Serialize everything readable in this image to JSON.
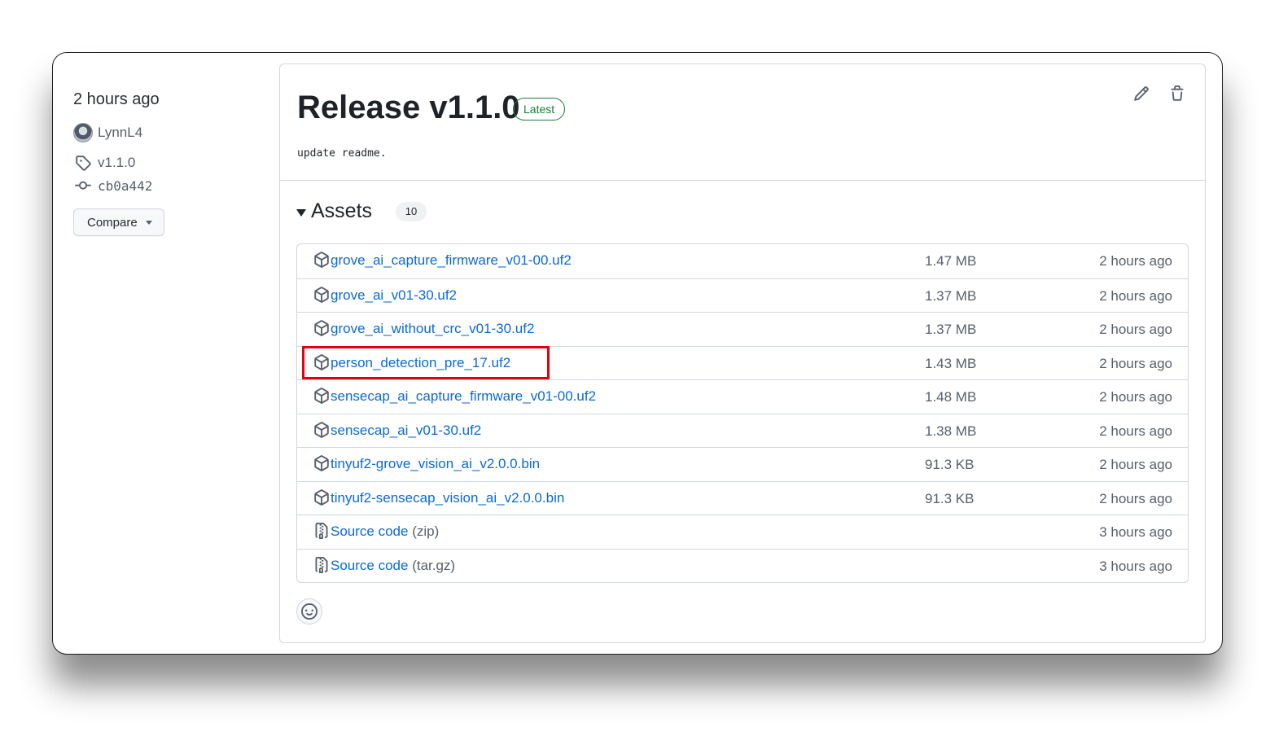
{
  "sidebar": {
    "time": "2 hours ago",
    "author": "LynnL4",
    "tag": "v1.1.0",
    "commit": "cb0a442",
    "compare_label": "Compare"
  },
  "release": {
    "title": "Release v1.1.0",
    "badge": "Latest",
    "body": "update readme.",
    "actions": [
      "pencil-icon",
      "trash-icon"
    ]
  },
  "assets": {
    "title": "Assets",
    "count": "10",
    "items": [
      {
        "name": "grove_ai_capture_firmware_v01-00.uf2",
        "size": "1.47 MB",
        "time": "2 hours ago",
        "icon": "package-icon"
      },
      {
        "name": "grove_ai_v01-30.uf2",
        "size": "1.37 MB",
        "time": "2 hours ago",
        "icon": "package-icon"
      },
      {
        "name": "grove_ai_without_crc_v01-30.uf2",
        "size": "1.37 MB",
        "time": "2 hours ago",
        "icon": "package-icon"
      },
      {
        "name": "person_detection_pre_17.uf2",
        "size": "1.43 MB",
        "time": "2 hours ago",
        "icon": "package-icon",
        "highlighted": true
      },
      {
        "name": "sensecap_ai_capture_firmware_v01-00.uf2",
        "size": "1.48 MB",
        "time": "2 hours ago",
        "icon": "package-icon"
      },
      {
        "name": "sensecap_ai_v01-30.uf2",
        "size": "1.38 MB",
        "time": "2 hours ago",
        "icon": "package-icon"
      },
      {
        "name": "tinyuf2-grove_vision_ai_v2.0.0.bin",
        "size": "91.3 KB",
        "time": "2 hours ago",
        "icon": "package-icon"
      },
      {
        "name": "tinyuf2-sensecap_vision_ai_v2.0.0.bin",
        "size": "91.3 KB",
        "time": "2 hours ago",
        "icon": "package-icon"
      },
      {
        "name": "Source code",
        "sub": "(zip)",
        "size": "",
        "time": "3 hours ago",
        "icon": "file-zip-icon"
      },
      {
        "name": "Source code",
        "sub": "(tar.gz)",
        "size": "",
        "time": "3 hours ago",
        "icon": "file-zip-icon"
      }
    ]
  },
  "colors": {
    "link": "#0969da",
    "badge_green": "#1a7f37",
    "highlight": "#e3000f"
  }
}
